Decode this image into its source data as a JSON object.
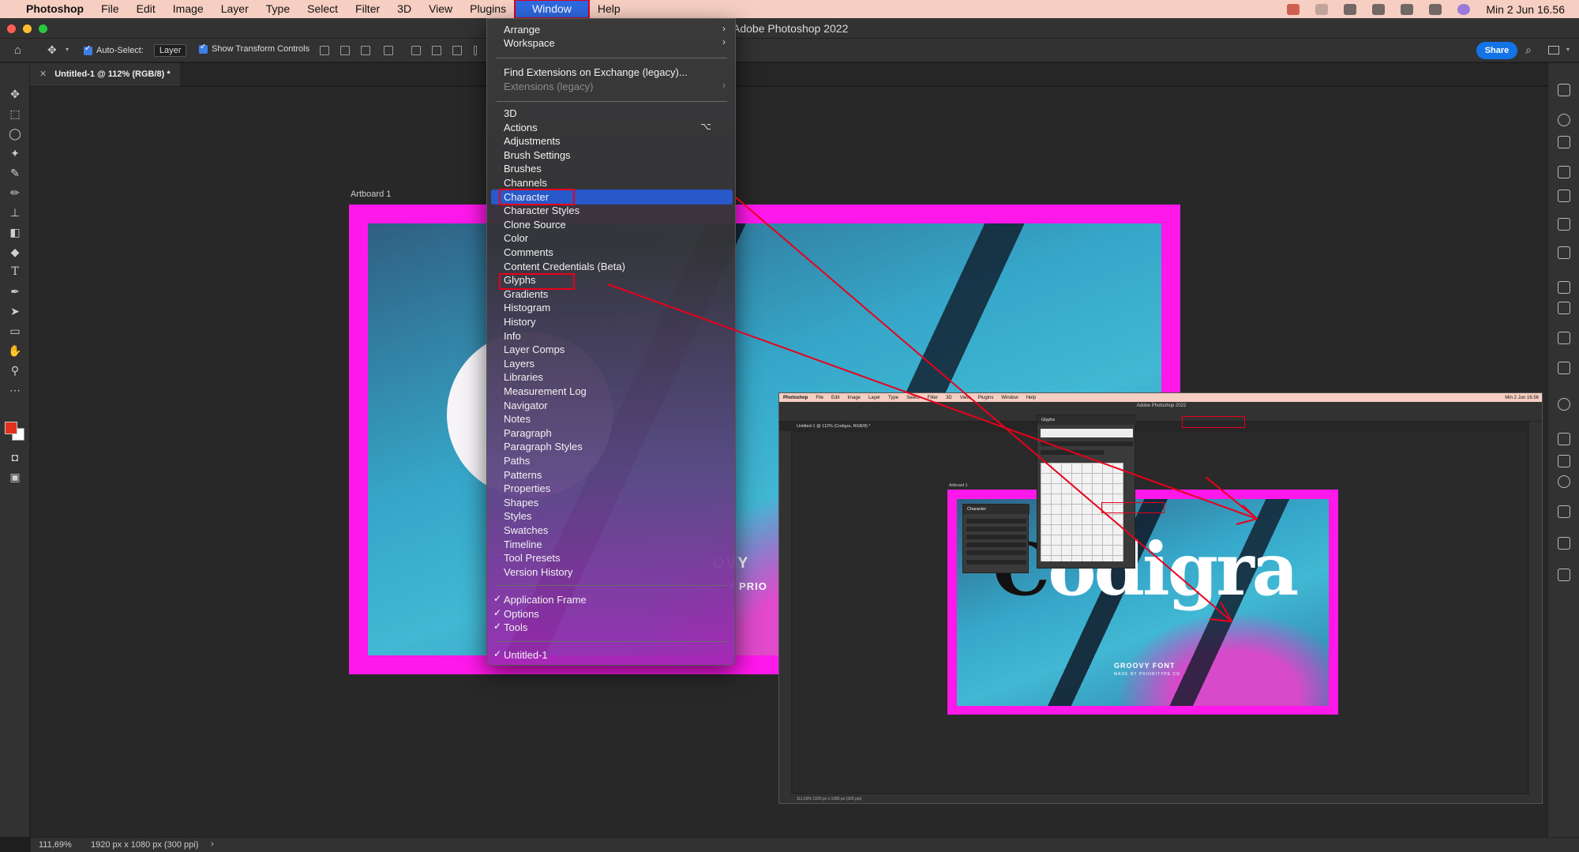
{
  "menubar": {
    "app_name": "Photoshop",
    "items": [
      "File",
      "Edit",
      "Image",
      "Layer",
      "Type",
      "Select",
      "Filter",
      "3D",
      "View",
      "Plugins",
      "Window",
      "Help"
    ],
    "clock": "Min 2 Jun  16.56"
  },
  "titlebar": {
    "title": "Adobe Photoshop 2022"
  },
  "options": {
    "auto_select_label": "Auto-Select:",
    "auto_select_value": "Layer",
    "transform_label": "Show Transform Controls",
    "share_label": "Share"
  },
  "document": {
    "tab_title": "Untitled-1 @ 112% (RGB/8) *",
    "artboard_label": "Artboard 1",
    "groovy_partial": "OVY",
    "priori_partial": "Y PRIO"
  },
  "status": {
    "zoom": "111,69%",
    "size": "1920 px x 1080 px (300 ppi)",
    "arrow": "›"
  },
  "window_menu": {
    "group1": [
      {
        "label": "Arrange",
        "sub": "›"
      },
      {
        "label": "Workspace",
        "sub": "›"
      }
    ],
    "group2": [
      {
        "label": "Find Extensions on Exchange (legacy)..."
      },
      {
        "label": "Extensions (legacy)",
        "sub": "›",
        "disabled": true
      }
    ],
    "group3": [
      "3D",
      "Actions",
      "Adjustments",
      "Brush Settings",
      "Brushes",
      "Channels",
      "Character",
      "Character Styles",
      "Clone Source",
      "Color",
      "Comments",
      "Content Credentials (Beta)",
      "Glyphs",
      "Gradients",
      "Histogram",
      "History",
      "Info",
      "Layer Comps",
      "Layers",
      "Libraries",
      "Measurement Log",
      "Navigator",
      "Notes",
      "Paragraph",
      "Paragraph Styles",
      "Paths",
      "Patterns",
      "Properties",
      "Shapes",
      "Styles",
      "Swatches",
      "Timeline",
      "Tool Presets",
      "Version History"
    ],
    "actions_shortcut": "⌥",
    "group4": [
      "Application Frame",
      "Options",
      "Tools"
    ],
    "group5": [
      "Untitled-1"
    ],
    "check": "✓"
  },
  "inset": {
    "menubar_items": [
      "Photoshop",
      "File",
      "Edit",
      "Image",
      "Layer",
      "Type",
      "Select",
      "Filter",
      "3D",
      "View",
      "Plugins",
      "Window",
      "Help"
    ],
    "clock": "Min 2 Jun  16.56",
    "title": "Adobe Photoshop 2022",
    "tab_title": "Untitled-1 @ 112% (Codigra, RGB/8) *",
    "artboard_label": "Artboard 1",
    "headline": "Codigra",
    "headline_first": "C",
    "groovy": "GROOVY FONT",
    "made_by": "MADE BY PRIORITYPE CO",
    "glyphs_title": "Glyphs",
    "character_title": "Character",
    "status": "111,69%     1920 px x 1080 px (300 ppi)"
  },
  "colors": {
    "accent": "#2858c9",
    "annotation": "#e8001c",
    "artboard": "#ff18ea",
    "menubar": "#f6cfc2"
  }
}
